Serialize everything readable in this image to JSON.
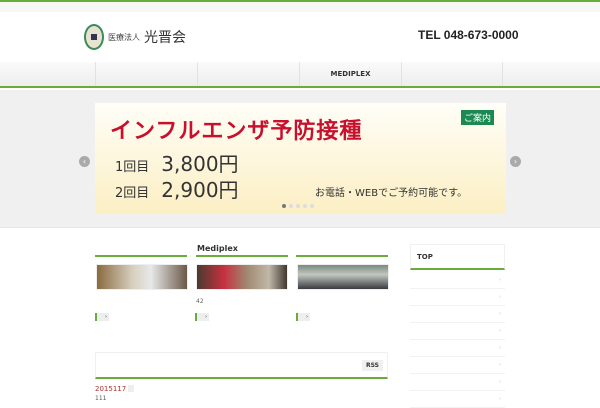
{
  "header": {
    "org_prefix": "医療法人",
    "org_name": "光晋会",
    "tel": "TEL 048-673-0000"
  },
  "nav": {
    "items": [
      "",
      "",
      "MEDIPLEX",
      "",
      ""
    ]
  },
  "slider": {
    "title": "インフルエンザ予防接種",
    "badge": "ご案内",
    "rows": [
      {
        "label": "1回目",
        "price": "3,800円"
      },
      {
        "label": "2回目",
        "price": "2,900円"
      }
    ],
    "note": "お電話・WEBでご予約可能です。",
    "prev": "‹",
    "next": "›",
    "slide_count": 5,
    "active_slide": 1
  },
  "main": {
    "section_title": "Mediplex",
    "count": "42",
    "rss": "RSS",
    "news": [
      {
        "date": "2015117",
        "title": "111"
      }
    ]
  },
  "sidebar": {
    "title": "TOP",
    "row_count": 8
  }
}
